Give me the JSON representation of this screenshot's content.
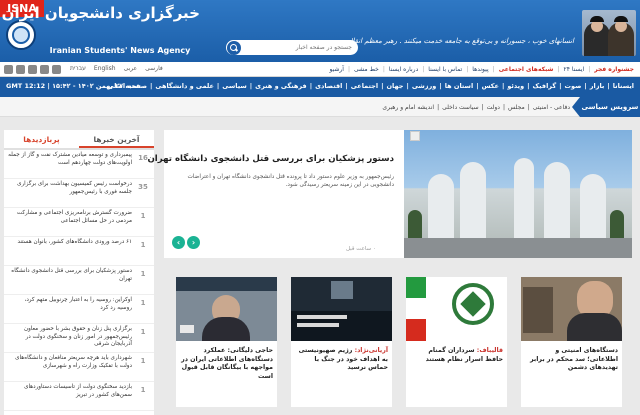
{
  "header": {
    "badge": "ISNA",
    "agency_fa": "خبرگزاری دانشجویان ایران ، ایسنا",
    "agency_en": "Iranian Students' News Agency",
    "slogan": "انسانهای خوب ، جسورانه و بی‌توقع به جامعه خدمت میکنند . رهبر معظم انقلاب",
    "search_placeholder": "جستجو در صفحه اخبار"
  },
  "nav": {
    "items": [
      "آرشیو",
      "خط مشی",
      "درباره ایسنا",
      "تماس با ایسنا",
      "پیوندها",
      "شبکه‌های اجتماعی",
      "ایسنا ۲۴",
      "جشنواره فجر"
    ],
    "langs": [
      "English",
      "عربی",
      "فارسی",
      "עברית"
    ]
  },
  "bar2": {
    "datetime": "GMT 12:12 | شنبه ۲۷ بهمن ۱۴۰۲ - ۱۵:۴۲",
    "links": [
      "صفحه اصلی",
      "علمی و دانشگاهی",
      "سیاسی",
      "فرهنگی و هنری",
      "اقتصادی",
      "اجتماعی",
      "جهان",
      "ورزشی",
      "استان ها",
      "عکس",
      "ویدئو",
      "گرافیک",
      "صوت",
      "بازار",
      "ایسنانا"
    ]
  },
  "bar3": {
    "service": "سرویس سیاسی",
    "subnav": [
      "اندیشه امام و رهبری",
      "سیاست داخلی",
      "دولت",
      "مجلس",
      "دفاعی - امنیتی"
    ]
  },
  "sidebar": {
    "tabs": [
      "آخرین خبرها",
      "پربازدیدها"
    ],
    "items": [
      {
        "badge": "16",
        "text": "پیمبرداری و توسعه میادین مشترک نفت و گاز از جمله اولویت‌های دولت چهاردهم است"
      },
      {
        "badge": "35",
        "text": "درخواست رئیس کمیسیون بهداشت برای برگزاری جلسه فوری با رئیس‌جمهور"
      },
      {
        "badge": "1",
        "text": "ضرورت گسترش برنامه‌ریزی اجتماعی و مشارکت مردمی در حل مسائل اجتماعی"
      },
      {
        "badge": "1",
        "text": "۶۱ درصد ورودی دانشگاه‌های کشور، بانوان هستند"
      },
      {
        "badge": "1",
        "text": "دستور پزشکیان برای بررسی قتل دانشجوی دانشگاه تهران"
      },
      {
        "badge": "1",
        "text": "اوکراین: روسیه را به اعتبار چرنوبیل متهم کرد، روسیه رد کرد"
      },
      {
        "badge": "1",
        "text": "برگزاری پنل زنان و حقوق بشر با حضور معاون رئیس‌جمهور در امور زنان و سخنگوی دولت در آذربایجان شرقی"
      },
      {
        "badge": "1",
        "text": "شهرداری باید هرچه سریعتر منافعان و دانشگاه‌های دولت با تفکیک وزارت راه و شهرسازی"
      },
      {
        "badge": "1",
        "text": "بازدید سخنگوی دولت از تاسیسات دستاوردهای سمن‌های کشور در تبریز"
      }
    ]
  },
  "featured": {
    "title": "دستور پزشکیان برای بررسی قتل دانشجوی دانشگاه تهران",
    "body": "رئیس‌جمهور به وزیر علوم دستور داد تا پرونده قتل دانشجوی دانشگاه تهران و اعتراضات دانشجویی در این زمینه سریعتر رسیدگی شود.",
    "time": "۰ ساعت قبل"
  },
  "cards": [
    {
      "pre": "",
      "title": "حاجی دلیگانی: عملکرد دستگاه‌های اطلاعاتی ایران در مواجهه با بیگانگان قابل قبول است"
    },
    {
      "pre": "آریانی‌نژاد:",
      "title": " رژیم صهیونیستی به اهداف خود در جنگ با حماس نرسید"
    },
    {
      "pre": "قالیباف:",
      "title": " سرداران گمنام حافظ اسرار نظام هستند"
    },
    {
      "pre": "",
      "title": "دستگاه‌های امنیتی و اطلاعاتی؛ سد محکم در برابر تهدیدهای دشمن"
    }
  ]
}
